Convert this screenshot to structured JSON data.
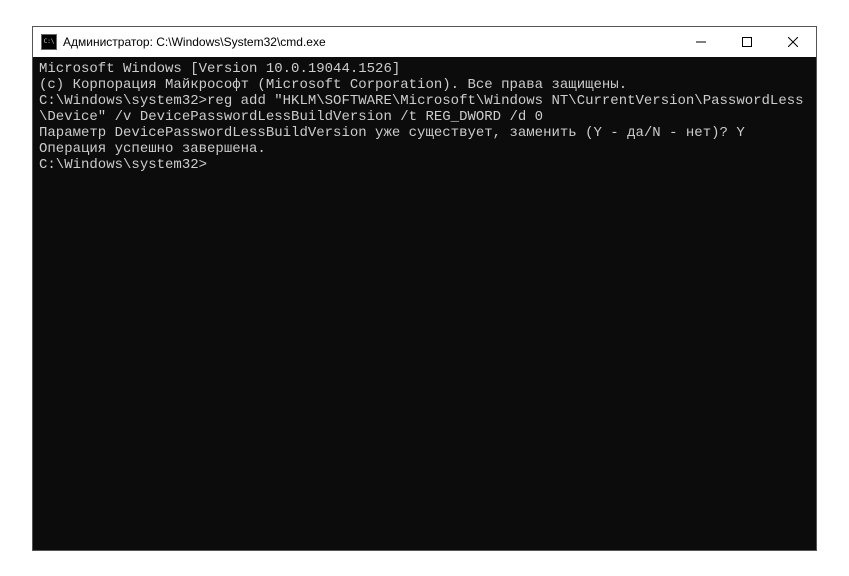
{
  "window": {
    "title": "Администратор: C:\\Windows\\System32\\cmd.exe"
  },
  "terminal": {
    "line1": "Microsoft Windows [Version 10.0.19044.1526]",
    "line2": "(c) Корпорация Майкрософт (Microsoft Corporation). Все права защищены.",
    "blank1": "",
    "prompt1": "C:\\Windows\\system32>",
    "command1": "reg add \"HKLM\\SOFTWARE\\Microsoft\\Windows NT\\CurrentVersion\\PasswordLess\\Device\" /v DevicePasswordLessBuildVersion /t REG_DWORD /d 0",
    "confirm_question": "Параметр DevicePasswordLessBuildVersion уже существует, заменить (Y - да/N - нет)? ",
    "confirm_answer": "Y",
    "result": "Операция успешно завершена.",
    "blank2": "",
    "prompt2": "C:\\Windows\\system32>"
  }
}
